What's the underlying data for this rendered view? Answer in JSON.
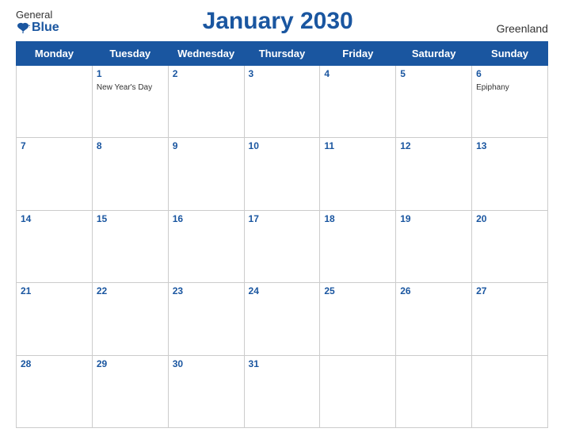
{
  "header": {
    "logo_general": "General",
    "logo_blue": "Blue",
    "title": "January 2030",
    "region": "Greenland"
  },
  "weekdays": [
    "Monday",
    "Tuesday",
    "Wednesday",
    "Thursday",
    "Friday",
    "Saturday",
    "Sunday"
  ],
  "weeks": [
    [
      {
        "day": "",
        "empty": true
      },
      {
        "day": "1",
        "event": "New Year's Day"
      },
      {
        "day": "2",
        "event": ""
      },
      {
        "day": "3",
        "event": ""
      },
      {
        "day": "4",
        "event": ""
      },
      {
        "day": "5",
        "event": ""
      },
      {
        "day": "6",
        "event": "Epiphany"
      }
    ],
    [
      {
        "day": "7",
        "event": ""
      },
      {
        "day": "8",
        "event": ""
      },
      {
        "day": "9",
        "event": ""
      },
      {
        "day": "10",
        "event": ""
      },
      {
        "day": "11",
        "event": ""
      },
      {
        "day": "12",
        "event": ""
      },
      {
        "day": "13",
        "event": ""
      }
    ],
    [
      {
        "day": "14",
        "event": ""
      },
      {
        "day": "15",
        "event": ""
      },
      {
        "day": "16",
        "event": ""
      },
      {
        "day": "17",
        "event": ""
      },
      {
        "day": "18",
        "event": ""
      },
      {
        "day": "19",
        "event": ""
      },
      {
        "day": "20",
        "event": ""
      }
    ],
    [
      {
        "day": "21",
        "event": ""
      },
      {
        "day": "22",
        "event": ""
      },
      {
        "day": "23",
        "event": ""
      },
      {
        "day": "24",
        "event": ""
      },
      {
        "day": "25",
        "event": ""
      },
      {
        "day": "26",
        "event": ""
      },
      {
        "day": "27",
        "event": ""
      }
    ],
    [
      {
        "day": "28",
        "event": ""
      },
      {
        "day": "29",
        "event": ""
      },
      {
        "day": "30",
        "event": ""
      },
      {
        "day": "31",
        "event": ""
      },
      {
        "day": "",
        "empty": true
      },
      {
        "day": "",
        "empty": true
      },
      {
        "day": "",
        "empty": true
      }
    ]
  ]
}
